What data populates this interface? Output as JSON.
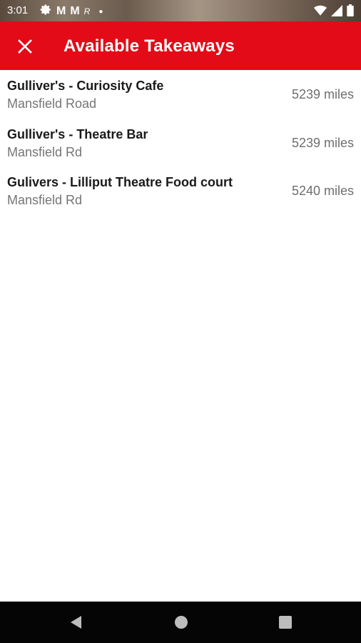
{
  "status_bar": {
    "time": "3:01",
    "left_icons": [
      "gear-icon",
      "gmail-icon",
      "gmail-icon",
      "app-icon",
      "dot-icon"
    ],
    "m1": "M",
    "m2": "M",
    "small": "R",
    "right_icons": [
      "wifi-icon",
      "signal-icon",
      "battery-icon"
    ]
  },
  "header": {
    "title": "Available Takeaways",
    "close_icon": "close-icon",
    "color": "#e30b17"
  },
  "takeaways": [
    {
      "name": "Gulliver's - Curiosity Cafe",
      "address": "Mansfield Road",
      "distance": "5239 miles"
    },
    {
      "name": "Gulliver's - Theatre Bar",
      "address": "Mansfield Rd",
      "distance": "5239 miles"
    },
    {
      "name": "Gulivers - Lilliput Theatre Food court",
      "address": "Mansfield Rd",
      "distance": "5240 miles"
    }
  ],
  "nav_bar": {
    "buttons": [
      "back-icon",
      "home-icon",
      "recents-icon"
    ]
  }
}
